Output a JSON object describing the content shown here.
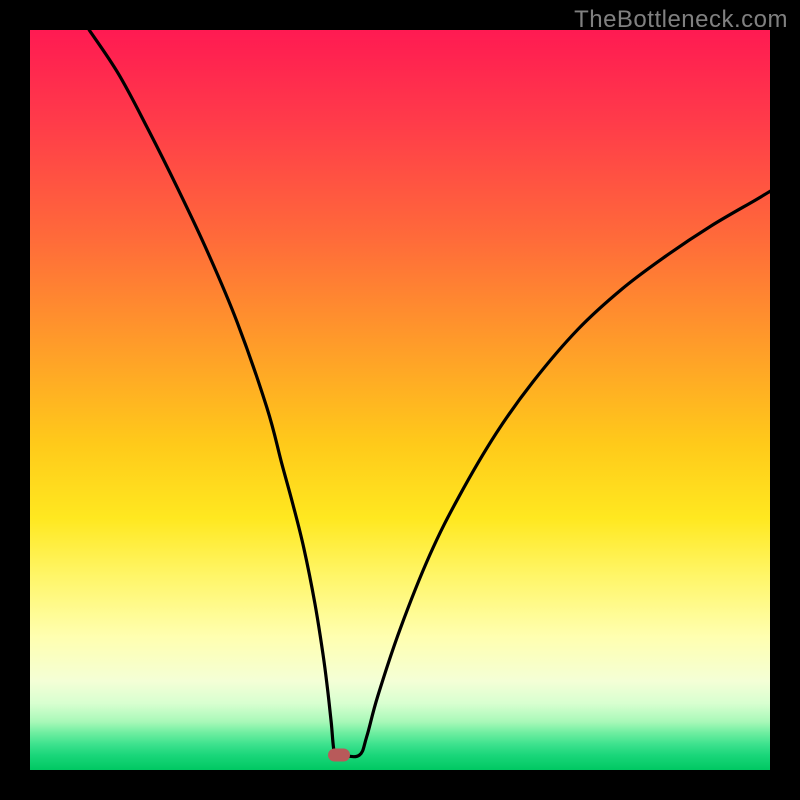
{
  "watermark": "TheBottleneck.com",
  "chart_data": {
    "type": "line",
    "title": "",
    "xlabel": "",
    "ylabel": "",
    "xlim": [
      0,
      100
    ],
    "ylim": [
      0,
      100
    ],
    "grid": false,
    "series": [
      {
        "name": "curve",
        "x": [
          8,
          12,
          16,
          20,
          24,
          28,
          32,
          34,
          35.5,
          37,
          38.5,
          39.6,
          40.2,
          40.7,
          41.2,
          42.2,
          44.5,
          45.5,
          47,
          50,
          54,
          58,
          63,
          68,
          74,
          80,
          86,
          92,
          98,
          100
        ],
        "y": [
          100,
          94,
          86.5,
          78.5,
          70,
          60.5,
          49,
          41.5,
          36,
          30,
          22.5,
          15.6,
          11,
          6.5,
          2,
          2,
          2,
          4.5,
          10,
          19,
          29,
          37,
          45.5,
          52.5,
          59.5,
          65,
          69.5,
          73.5,
          77,
          78.2
        ]
      }
    ],
    "marker": {
      "x": 41.7,
      "y": 2
    },
    "gradient_stops": [
      {
        "pct": 0,
        "color": "#ff1a52"
      },
      {
        "pct": 56,
        "color": "#ffca1a"
      },
      {
        "pct": 82,
        "color": "#ffffb0"
      },
      {
        "pct": 100,
        "color": "#00c862"
      }
    ]
  }
}
